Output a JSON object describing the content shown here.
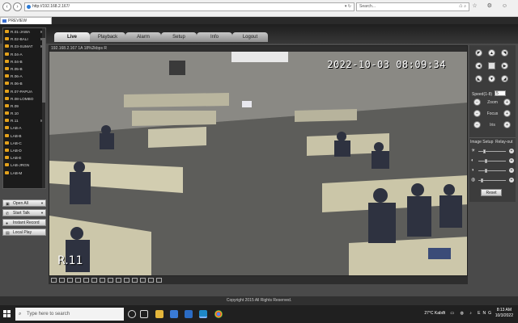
{
  "browser": {
    "address": "http://192.168.2.167/",
    "address_end": "▾ ↻",
    "search_placeholder": "Search...",
    "tab_title": "PREVIEW",
    "right_icons": "⌂ ☆ ⚙ ☺",
    "window_controls": "— ▢ ✕"
  },
  "app": {
    "logo": "alhua",
    "menu": [
      "Live",
      "Playback",
      "Alarm",
      "Setup",
      "Info",
      "Logout"
    ],
    "active_menu": "Live",
    "cameras": [
      {
        "label": "R.01-JAWA",
        "mark": "M"
      },
      {
        "label": "R.02-BALI",
        "mark": "M"
      },
      {
        "label": "R.03-SUMAT",
        "mark": "M"
      },
      {
        "label": "R.04-A",
        "mark": ""
      },
      {
        "label": "R.04-B",
        "mark": ""
      },
      {
        "label": "R.05-B",
        "mark": ""
      },
      {
        "label": "R.06-A",
        "mark": ""
      },
      {
        "label": "R.06-B",
        "mark": ""
      },
      {
        "label": "R.07-PAPUA",
        "mark": ""
      },
      {
        "label": "R.08-LOMBO",
        "mark": ""
      },
      {
        "label": "R.09",
        "mark": ""
      },
      {
        "label": "R.10",
        "mark": ""
      },
      {
        "label": "R.11",
        "mark": "M"
      },
      {
        "label": "LAB-A",
        "mark": ""
      },
      {
        "label": "LAB-B",
        "mark": ""
      },
      {
        "label": "LAB-C",
        "mark": ""
      },
      {
        "label": "LAB-D",
        "mark": ""
      },
      {
        "label": "LAB-E",
        "mark": ""
      },
      {
        "label": "LAB-JRGN",
        "mark": ""
      },
      {
        "label": "LAB-M",
        "mark": ""
      }
    ],
    "side_buttons": [
      {
        "label": "Open All",
        "icon": "▣"
      },
      {
        "label": "Start Talk",
        "icon": "✆"
      },
      {
        "label": "Instant Record",
        "icon": "●"
      },
      {
        "label": "Local Play",
        "icon": "▤"
      }
    ],
    "video": {
      "info_bar": "192.168.2.167 1A 18%2kbps R",
      "timestamp": "2022-10-03 08:09:34",
      "channel_name": "R.11"
    },
    "ptz": {
      "speed_label": "Speed(1-8)",
      "speed_value": "5",
      "zoom": "Zoom",
      "focus": "Focus",
      "iris": "Iris",
      "minus": "−",
      "plus": "+"
    },
    "image_setup": {
      "title": "Image Setup",
      "relay": "Relay-out",
      "reset": "Reset",
      "sliders": [
        {
          "icon": "☀",
          "level": 0.2
        },
        {
          "icon": "◐",
          "level": 0.25
        },
        {
          "icon": "◑",
          "level": 0.25
        },
        {
          "icon": "◍",
          "level": 0.1
        }
      ]
    },
    "footer": "Copyright 2015 All Rights Reserved."
  },
  "taskbar": {
    "search_placeholder": "Type here to search",
    "weather": "27°C Kabut",
    "tray_icons": "^ ▭ ◍ ♪ ENG",
    "time": "8:13 AM",
    "date": "10/3/2022"
  },
  "colors": {
    "camera_icon": "#e3a11b",
    "app_bg": "#4a4a4a"
  }
}
